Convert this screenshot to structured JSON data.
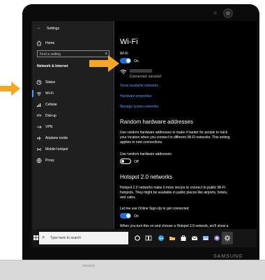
{
  "sidebar": {
    "back_icon": "back-arrow-icon",
    "title": "Settings",
    "home": "Home",
    "search_placeholder": "Find a setting",
    "section_title": "Network & Internet",
    "items": [
      {
        "label": "Status",
        "icon": "status-icon"
      },
      {
        "label": "Wi-Fi",
        "icon": "wifi-icon"
      },
      {
        "label": "Cellular",
        "icon": "cellular-icon"
      },
      {
        "label": "Dial-up",
        "icon": "dialup-icon"
      },
      {
        "label": "VPN",
        "icon": "vpn-icon"
      },
      {
        "label": "Airplane mode",
        "icon": "airplane-icon"
      },
      {
        "label": "Mobile hotspot",
        "icon": "hotspot-icon"
      },
      {
        "label": "Proxy",
        "icon": "proxy-icon"
      }
    ]
  },
  "main": {
    "page_title": "Wi-Fi",
    "wifi_label": "Wi-Fi",
    "wifi_state": "On",
    "network_status": "Connected, secured",
    "links": [
      "Show available networks",
      "Hardware properties",
      "Manage known networks"
    ],
    "random_title": "Random hardware addresses",
    "random_desc1": "Use random hardware addresses to make it harder for people to track",
    "random_desc2": "your location when you connect to different Wi-Fi networks. This setting",
    "random_desc3": "applies to new connections.",
    "random_toggle_label": "Use random hardware addresses",
    "random_state": "Off",
    "hotspot_title": "Hotspot 2.0 networks",
    "hotspot_desc1": "Hotspot 2.0 networks make it more secure to connect to public Wi-Fi",
    "hotspot_desc2": "hotspots. They might be available in public places like airports, hotels,",
    "hotspot_desc3": "and cafes.",
    "online_signup_label": "Let me use Online Sign-Up to get connected",
    "online_signup_state": "On",
    "bottom_text": "When you turn this on and choose a Hotspot 2.0 network, we'll show a"
  },
  "taskbar": {
    "search_placeholder": "Type here to search"
  },
  "device": {
    "brand": "SAMSUNG"
  },
  "colors": {
    "accent": "#1f6fd6",
    "link": "#4aa3ff",
    "arrow": "#f5a623"
  }
}
